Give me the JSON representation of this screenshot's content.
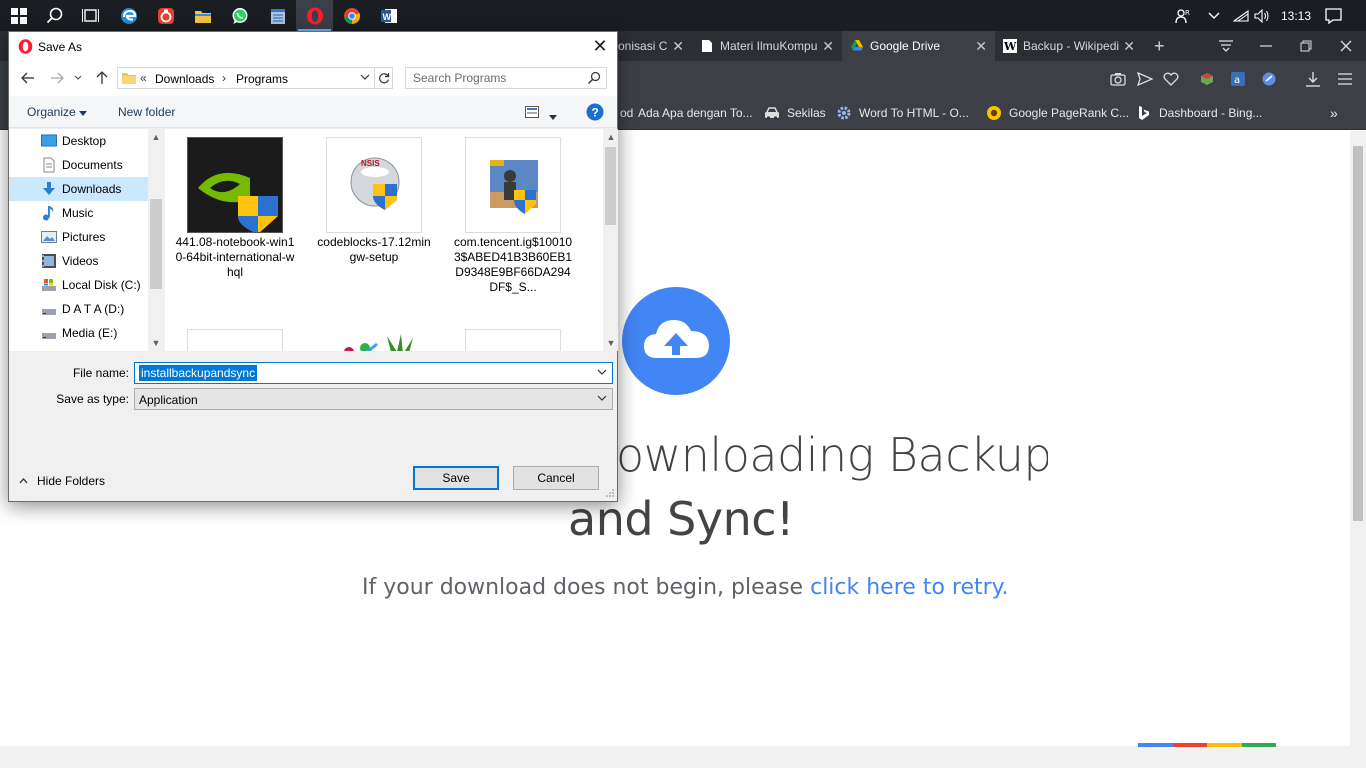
{
  "taskbar": {
    "clock": "13:13",
    "apps": [
      "windows-icon",
      "search-icon",
      "task-view-icon",
      "edge-icon",
      "app-red-icon",
      "file-explorer-icon",
      "whatsapp-icon",
      "notepad-icon",
      "opera-icon",
      "chrome-icon",
      "word-icon"
    ],
    "active_app": "opera-icon"
  },
  "browser": {
    "tabs": [
      {
        "label": "onisasi C",
        "active": false
      },
      {
        "label": "Materi IlmuKompu",
        "active": false
      },
      {
        "label": "Google Drive",
        "active": true
      },
      {
        "label": "Backup - Wikipedi",
        "active": false
      }
    ],
    "bookmarks": [
      {
        "label": "od",
        "icon": "red-bookmark-icon"
      },
      {
        "label": "Ada Apa dengan To...",
        "icon": "bookmark-icon"
      },
      {
        "label": "Sekilas",
        "icon": "car-icon"
      },
      {
        "label": "Word To HTML - O...",
        "icon": "gear-icon"
      },
      {
        "label": "Google PageRank C...",
        "icon": "sunflower-icon"
      },
      {
        "label": "Dashboard - Bing...",
        "icon": "bing-icon"
      }
    ],
    "more_bookmarks": "»"
  },
  "page": {
    "heading_line1": "ownloading Backup",
    "heading_line2": "and Sync!",
    "retry_text": "If your download does not begin, please ",
    "retry_link": "click here to retry."
  },
  "dialog": {
    "title": "Save As",
    "breadcrumb": {
      "overflow": "«",
      "items": [
        "Downloads",
        "Programs"
      ],
      "separator": "›"
    },
    "search_placeholder": "Search Programs",
    "organize_label": "Organize",
    "new_folder_label": "New folder",
    "help_label": "?",
    "nav_items": [
      {
        "label": "Desktop",
        "icon": "desktop-icon",
        "selected": false
      },
      {
        "label": "Documents",
        "icon": "documents-icon",
        "selected": false
      },
      {
        "label": "Downloads",
        "icon": "downloads-icon",
        "selected": true
      },
      {
        "label": "Music",
        "icon": "music-icon",
        "selected": false
      },
      {
        "label": "Pictures",
        "icon": "pictures-icon",
        "selected": false
      },
      {
        "label": "Videos",
        "icon": "videos-icon",
        "selected": false
      },
      {
        "label": "Local Disk (C:)",
        "icon": "local-disk-icon",
        "selected": false
      },
      {
        "label": "D A T A (D:)",
        "icon": "drive-icon",
        "selected": false
      },
      {
        "label": "Media (E:)",
        "icon": "drive-icon",
        "selected": false
      }
    ],
    "files": [
      {
        "name": "441.08-notebook-win10-64bit-international-whql",
        "icon": "nvidia-installer-icon"
      },
      {
        "name": "codeblocks-17.12mingw-setup",
        "icon": "nsis-installer-icon"
      },
      {
        "name": "com.tencent.ig$100103$ABED41B3B60EB1D9348E9BF66DA294DF$_S...",
        "icon": "pubg-installer-icon"
      },
      {
        "name": "",
        "icon": "app-installer-icon"
      },
      {
        "name": "",
        "icon": "tropical-drink-icon"
      },
      {
        "name": "",
        "icon": "disc-installer-icon"
      }
    ],
    "file_name_label": "File name:",
    "file_name_value": "installbackupandsync",
    "save_type_label": "Save as type:",
    "save_type_value": "Application",
    "hide_folders_label": "Hide Folders",
    "save_label": "Save",
    "cancel_label": "Cancel"
  },
  "colors": {
    "accent": "#0078d7",
    "drive_blue": "#4285f4",
    "selection": "#cce8ff",
    "taskbar": "#1a1d21",
    "browser_chrome": "#3c4046"
  }
}
